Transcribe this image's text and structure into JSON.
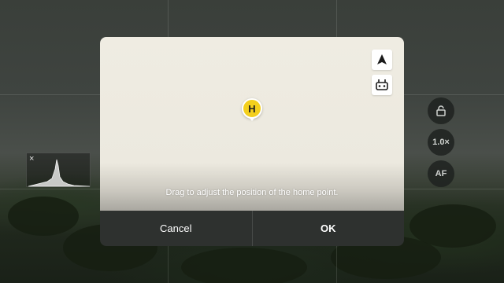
{
  "camera": {
    "zoom_label": "1.0×",
    "focus_label": "AF"
  },
  "dialog": {
    "hint": "Drag to adjust the position of the home point.",
    "home_marker_label": "H",
    "cancel_label": "Cancel",
    "ok_label": "OK",
    "map_buttons": [
      "navigation-arrow-icon",
      "remote-controller-icon"
    ]
  },
  "histogram": {
    "close_symbol": "×"
  },
  "colors": {
    "home_marker": "#f3cf1d",
    "dialog_footer": "#2e312f"
  }
}
